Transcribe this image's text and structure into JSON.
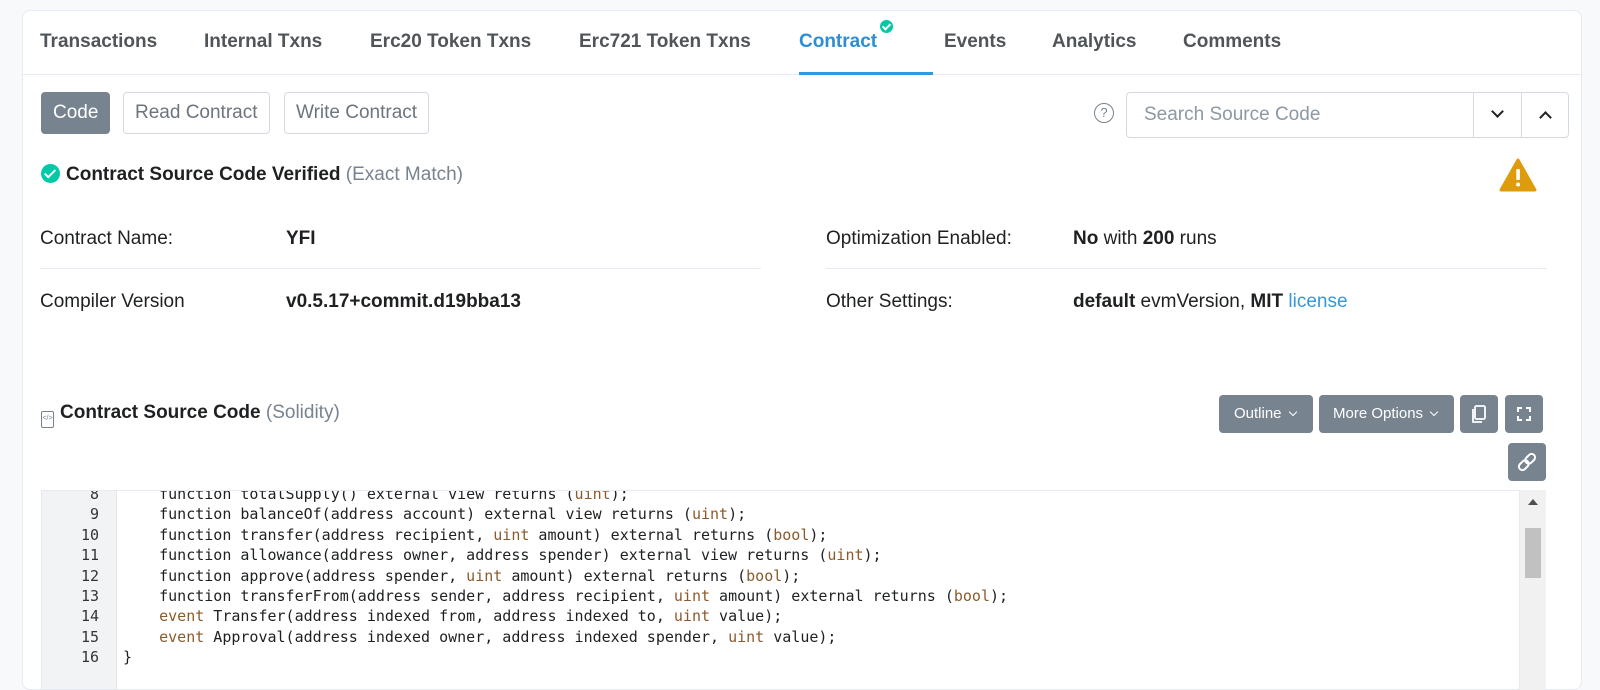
{
  "tabs": [
    {
      "label": "Transactions"
    },
    {
      "label": "Internal Txns"
    },
    {
      "label": "Erc20 Token Txns"
    },
    {
      "label": "Erc721 Token Txns"
    },
    {
      "label": "Contract"
    },
    {
      "label": "Events"
    },
    {
      "label": "Analytics"
    },
    {
      "label": "Comments"
    }
  ],
  "active_tab": "Contract",
  "subtabs": {
    "code": "Code",
    "read": "Read Contract",
    "write": "Write Contract"
  },
  "search": {
    "placeholder": "Search Source Code",
    "help_glyph": "?"
  },
  "verified": {
    "title": "Contract Source Code Verified",
    "note": "(Exact Match)"
  },
  "info": {
    "contract_name_label": "Contract Name:",
    "contract_name": "YFI",
    "compiler_label": "Compiler Version",
    "compiler": "v0.5.17+commit.d19bba13",
    "optimization_label": "Optimization Enabled:",
    "optimization": {
      "a": "No",
      "b": " with ",
      "c": "200",
      "d": " runs"
    },
    "other_label": "Other Settings:",
    "other": {
      "a": "default",
      "b": " evmVersion, ",
      "c": "MIT",
      "d": " ",
      "e": "license"
    }
  },
  "source": {
    "title": "Contract Source Code",
    "lang": "(Solidity)",
    "outline": "Outline",
    "more": "More Options",
    "lines": [
      {
        "n": "8",
        "pre": "    function totalSupply() external view returns (",
        "kw": "uint",
        "post": ");"
      },
      {
        "n": "9",
        "pre": "    function balanceOf(address account) external view returns (",
        "kw": "uint",
        "post": ");"
      },
      {
        "n": "10",
        "pre": "    function transfer(address recipient, ",
        "kw": "uint",
        "post": " amount) external returns (",
        "kw2": "bool",
        "post2": ");"
      },
      {
        "n": "11",
        "pre": "    function allowance(address owner, address spender) external view returns (",
        "kw": "uint",
        "post": ");"
      },
      {
        "n": "12",
        "pre": "    function approve(address spender, ",
        "kw": "uint",
        "post": " amount) external returns (",
        "kw2": "bool",
        "post2": ");"
      },
      {
        "n": "13",
        "pre": "    function transferFrom(address sender, address recipient, ",
        "kw": "uint",
        "post": " amount) external returns (",
        "kw2": "bool",
        "post2": ");"
      },
      {
        "n": "14",
        "pre": "    ",
        "kw": "event",
        "post": " Transfer(address indexed from, address indexed to, ",
        "kw2": "uint",
        "post2": " value);"
      },
      {
        "n": "15",
        "pre": "    ",
        "kw": "event",
        "post": " Approval(address indexed owner, address indexed spender, ",
        "kw2": "uint",
        "post2": " value);"
      },
      {
        "n": "16",
        "pre": "}",
        "kw": "",
        "post": ""
      }
    ]
  },
  "colors": {
    "accent": "#3498db",
    "verified": "#00c9a7",
    "warning": "#de9b0c",
    "button": "#77838f"
  }
}
